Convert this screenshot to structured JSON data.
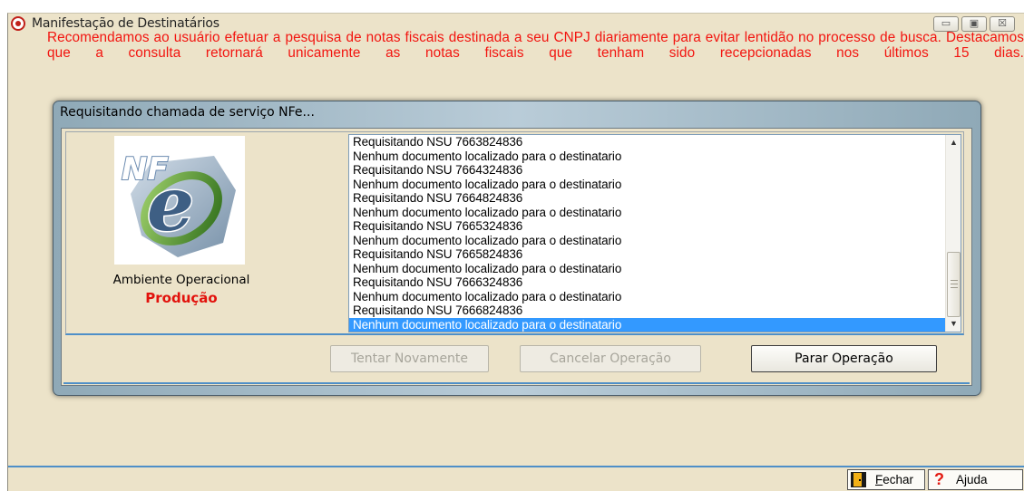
{
  "window": {
    "title": "Manifestação de Destinatários",
    "buttons": {
      "minimize": "▭",
      "maximize": "▣",
      "close": "☒"
    },
    "notice": "Recomendamos ao usuário efetuar a pesquisa de notas fiscais destinada a seu CNPJ diariamente para evitar lentidão no processo de busca. Destacamos que a consulta retornará unicamente as notas fiscais que tenham sido recepcionadas nos últimos 15 dias."
  },
  "dialog": {
    "title": "Requisitando chamada de serviço NFe...",
    "logo_text": "NFe",
    "environment_label": "Ambiente Operacional",
    "environment_value": "Produção",
    "log": [
      "Requisitando NSU 7663824836",
      "Nenhum documento localizado para o destinatario",
      "Requisitando NSU 7664324836",
      "Nenhum documento localizado para o destinatario",
      "Requisitando NSU 7664824836",
      "Nenhum documento localizado para o destinatario",
      "Requisitando NSU 7665324836",
      "Nenhum documento localizado para o destinatario",
      "Requisitando NSU 7665824836",
      "Nenhum documento localizado para o destinatario",
      "Requisitando NSU 7666324836",
      "Nenhum documento localizado para o destinatario",
      "Requisitando NSU 7666824836",
      "Nenhum documento localizado para o destinatario"
    ],
    "selected_index": 13,
    "buttons": {
      "retry": "Tentar Novamente",
      "cancel": "Cancelar Operação",
      "stop": "Parar Operação"
    }
  },
  "footer": {
    "close_prefix": "",
    "close_hotkey": "F",
    "close_rest": "echar",
    "help": "Ajuda"
  },
  "colors": {
    "notice_red": "#f2140f",
    "accent_blue": "#4e8fc8",
    "selection": "#3399ff",
    "window_bg": "#ece3c9"
  },
  "icons": [
    "app-radio-icon",
    "minimize-icon",
    "maximize-icon",
    "close-icon",
    "nfe-logo",
    "scroll-up-icon",
    "scroll-down-icon",
    "exit-door-icon",
    "help-question-icon"
  ]
}
